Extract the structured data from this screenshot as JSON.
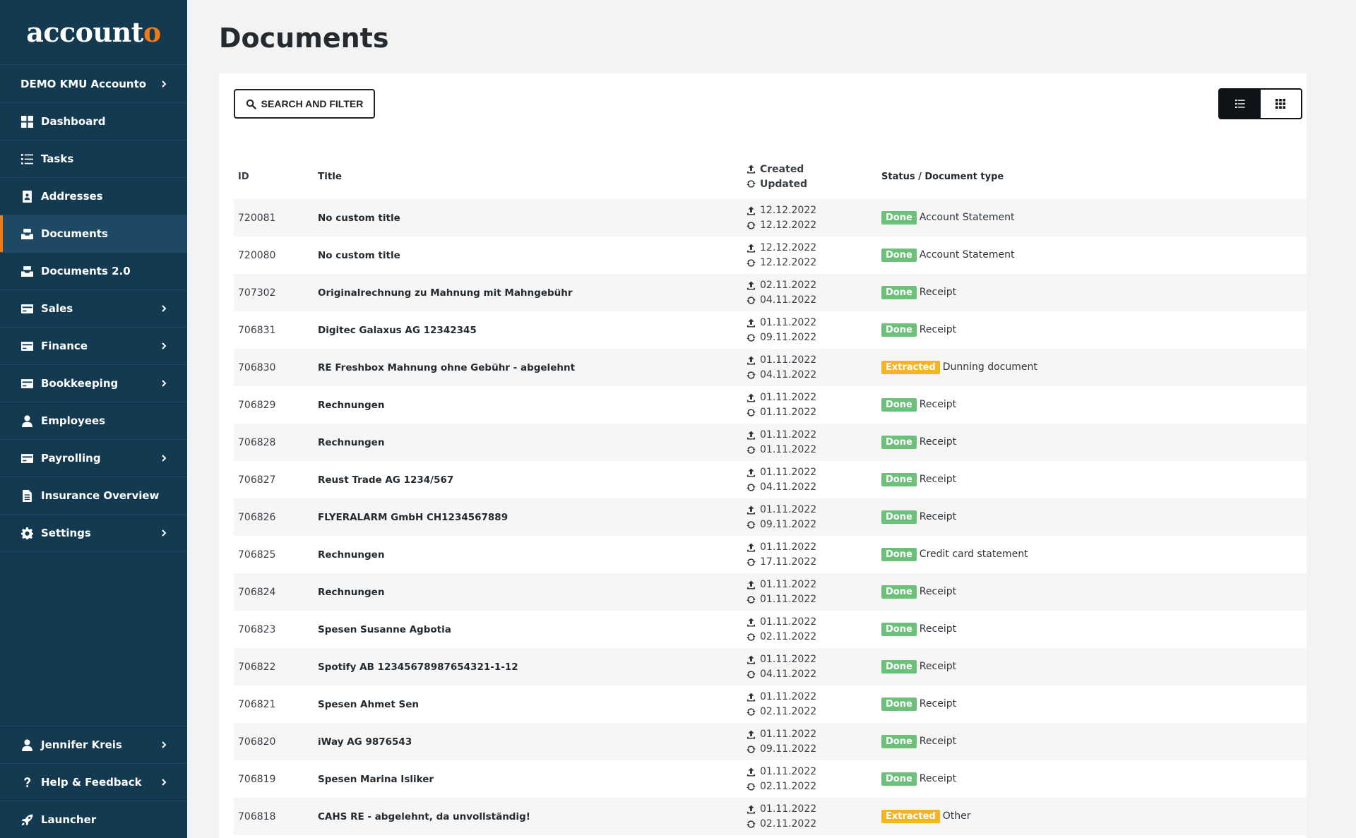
{
  "brand": {
    "name_main": "account",
    "name_accent": "o"
  },
  "sidebar": {
    "company": "DEMO KMU Accounto",
    "items": [
      {
        "label": "Dashboard",
        "icon": "dashboard-icon",
        "chevron": false,
        "active": false
      },
      {
        "label": "Tasks",
        "icon": "tasks-icon",
        "chevron": false,
        "active": false
      },
      {
        "label": "Addresses",
        "icon": "addressbook-icon",
        "chevron": false,
        "active": false
      },
      {
        "label": "Documents",
        "icon": "inbox-icon",
        "chevron": false,
        "active": true
      },
      {
        "label": "Documents 2.0",
        "icon": "inbox-icon",
        "chevron": false,
        "active": false
      },
      {
        "label": "Sales",
        "icon": "card-icon",
        "chevron": true,
        "active": false
      },
      {
        "label": "Finance",
        "icon": "card-icon",
        "chevron": true,
        "active": false
      },
      {
        "label": "Bookkeeping",
        "icon": "card-icon",
        "chevron": true,
        "active": false
      },
      {
        "label": "Employees",
        "icon": "user-icon",
        "chevron": false,
        "active": false
      },
      {
        "label": "Payrolling",
        "icon": "card-icon",
        "chevron": true,
        "active": false
      },
      {
        "label": "Insurance Overview",
        "icon": "document-icon",
        "chevron": false,
        "active": false
      },
      {
        "label": "Settings",
        "icon": "gear-icon",
        "chevron": true,
        "active": false
      }
    ],
    "bottom": [
      {
        "label": "Jennifer Kreis",
        "icon": "user-icon",
        "chevron": true
      },
      {
        "label": "Help & Feedback",
        "icon": "question-icon",
        "chevron": true
      },
      {
        "label": "Launcher",
        "icon": "rocket-icon",
        "chevron": false
      }
    ]
  },
  "page": {
    "title": "Documents",
    "search_label": "SEARCH AND FILTER"
  },
  "table": {
    "headers": {
      "id": "ID",
      "title": "Title",
      "created": "Created",
      "updated": "Updated",
      "status": "Status / Document type"
    },
    "rows": [
      {
        "id": "720081",
        "title": "No custom title",
        "created": "12.12.2022",
        "updated": "12.12.2022",
        "status": "Done",
        "type": "Account Statement"
      },
      {
        "id": "720080",
        "title": "No custom title",
        "created": "12.12.2022",
        "updated": "12.12.2022",
        "status": "Done",
        "type": "Account Statement"
      },
      {
        "id": "707302",
        "title": "Originalrechnung zu Mahnung mit Mahngebühr",
        "created": "02.11.2022",
        "updated": "04.11.2022",
        "status": "Done",
        "type": "Receipt"
      },
      {
        "id": "706831",
        "title": "Digitec Galaxus AG 12342345",
        "created": "01.11.2022",
        "updated": "09.11.2022",
        "status": "Done",
        "type": "Receipt"
      },
      {
        "id": "706830",
        "title": "RE Freshbox Mahnung ohne Gebühr - abgelehnt",
        "created": "01.11.2022",
        "updated": "04.11.2022",
        "status": "Extracted",
        "type": "Dunning document"
      },
      {
        "id": "706829",
        "title": "Rechnungen",
        "created": "01.11.2022",
        "updated": "01.11.2022",
        "status": "Done",
        "type": "Receipt"
      },
      {
        "id": "706828",
        "title": "Rechnungen",
        "created": "01.11.2022",
        "updated": "01.11.2022",
        "status": "Done",
        "type": "Receipt"
      },
      {
        "id": "706827",
        "title": "Reust Trade AG 1234/567",
        "created": "01.11.2022",
        "updated": "04.11.2022",
        "status": "Done",
        "type": "Receipt"
      },
      {
        "id": "706826",
        "title": "FLYERALARM GmbH CH1234567889",
        "created": "01.11.2022",
        "updated": "09.11.2022",
        "status": "Done",
        "type": "Receipt"
      },
      {
        "id": "706825",
        "title": "Rechnungen",
        "created": "01.11.2022",
        "updated": "17.11.2022",
        "status": "Done",
        "type": "Credit card statement"
      },
      {
        "id": "706824",
        "title": "Rechnungen",
        "created": "01.11.2022",
        "updated": "01.11.2022",
        "status": "Done",
        "type": "Receipt"
      },
      {
        "id": "706823",
        "title": "Spesen Susanne Agbotia",
        "created": "01.11.2022",
        "updated": "02.11.2022",
        "status": "Done",
        "type": "Receipt"
      },
      {
        "id": "706822",
        "title": "Spotify AB 12345678987654321-1-12",
        "created": "01.11.2022",
        "updated": "04.11.2022",
        "status": "Done",
        "type": "Receipt"
      },
      {
        "id": "706821",
        "title": "Spesen Ahmet Sen",
        "created": "01.11.2022",
        "updated": "02.11.2022",
        "status": "Done",
        "type": "Receipt"
      },
      {
        "id": "706820",
        "title": "iWay AG 9876543",
        "created": "01.11.2022",
        "updated": "09.11.2022",
        "status": "Done",
        "type": "Receipt"
      },
      {
        "id": "706819",
        "title": "Spesen Marina Isliker",
        "created": "01.11.2022",
        "updated": "02.11.2022",
        "status": "Done",
        "type": "Receipt"
      },
      {
        "id": "706818",
        "title": "CAHS RE - abgelehnt, da unvollständig!",
        "created": "01.11.2022",
        "updated": "02.11.2022",
        "status": "Extracted",
        "type": "Other"
      }
    ]
  },
  "colors": {
    "sidebar_bg": "#143a52",
    "accent": "#f07a1a",
    "done": "#6dc07a",
    "extracted": "#f6b322"
  }
}
